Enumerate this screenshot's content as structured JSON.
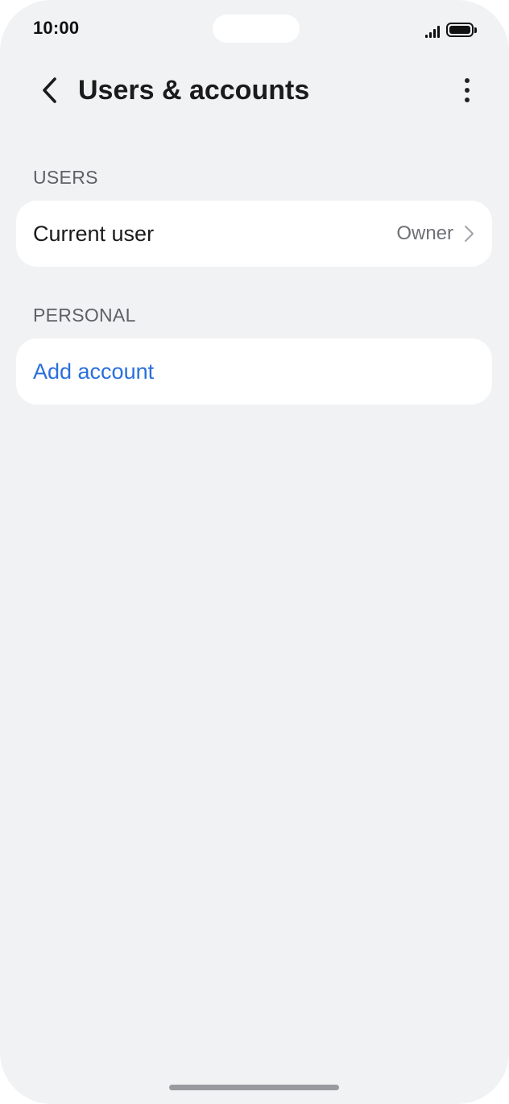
{
  "status_bar": {
    "time": "10:00"
  },
  "header": {
    "title": "Users & accounts",
    "back_icon": "chevron-left-icon",
    "more_icon": "more-vertical-icon"
  },
  "sections": {
    "users": {
      "header": "USERS",
      "current_user_label": "Current user",
      "current_user_value": "Owner"
    },
    "personal": {
      "header": "PERSONAL",
      "add_account_label": "Add account"
    }
  },
  "colors": {
    "background": "#f1f2f4",
    "card": "#ffffff",
    "accent": "#2a6fdb"
  }
}
